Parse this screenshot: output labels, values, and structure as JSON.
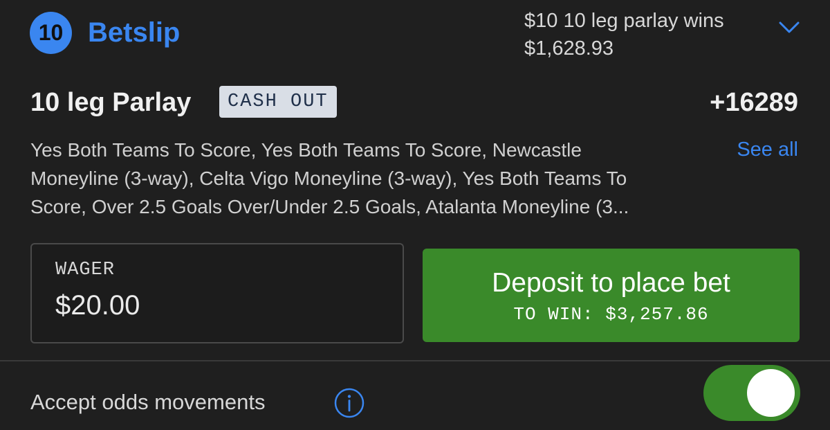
{
  "header": {
    "badge_count": "10",
    "title": "Betslip",
    "summary_line1": "$10 10 leg parlay wins",
    "summary_line2": "$1,628.93",
    "chevron_icon": "chevron-down-icon"
  },
  "parlay": {
    "title": "10 leg Parlay",
    "cashout_label": "CASH OUT",
    "odds": "+16289",
    "legs_line1": "Yes Both Teams To Score, Yes Both Teams To Score, Newcastle",
    "legs_line2": "Moneyline (3-way), Celta Vigo Moneyline (3-way), Yes Both Teams To",
    "legs_line3": "Score, Over 2.5 Goals Over/Under 2.5 Goals, Atalanta Moneyline (3...",
    "see_all_label": "See all"
  },
  "wager": {
    "label": "WAGER",
    "value": "$20.00"
  },
  "deposit": {
    "label": "Deposit to place bet",
    "to_win": "TO WIN: $3,257.86"
  },
  "settings": {
    "accept_odds_label": "Accept odds movements",
    "info_icon": "info-icon",
    "toggle_on": true
  },
  "colors": {
    "background": "#1f1f1f",
    "accent_blue": "#3a86f0",
    "action_green": "#3a8a2a",
    "cashout_bg": "#d9dee6"
  }
}
